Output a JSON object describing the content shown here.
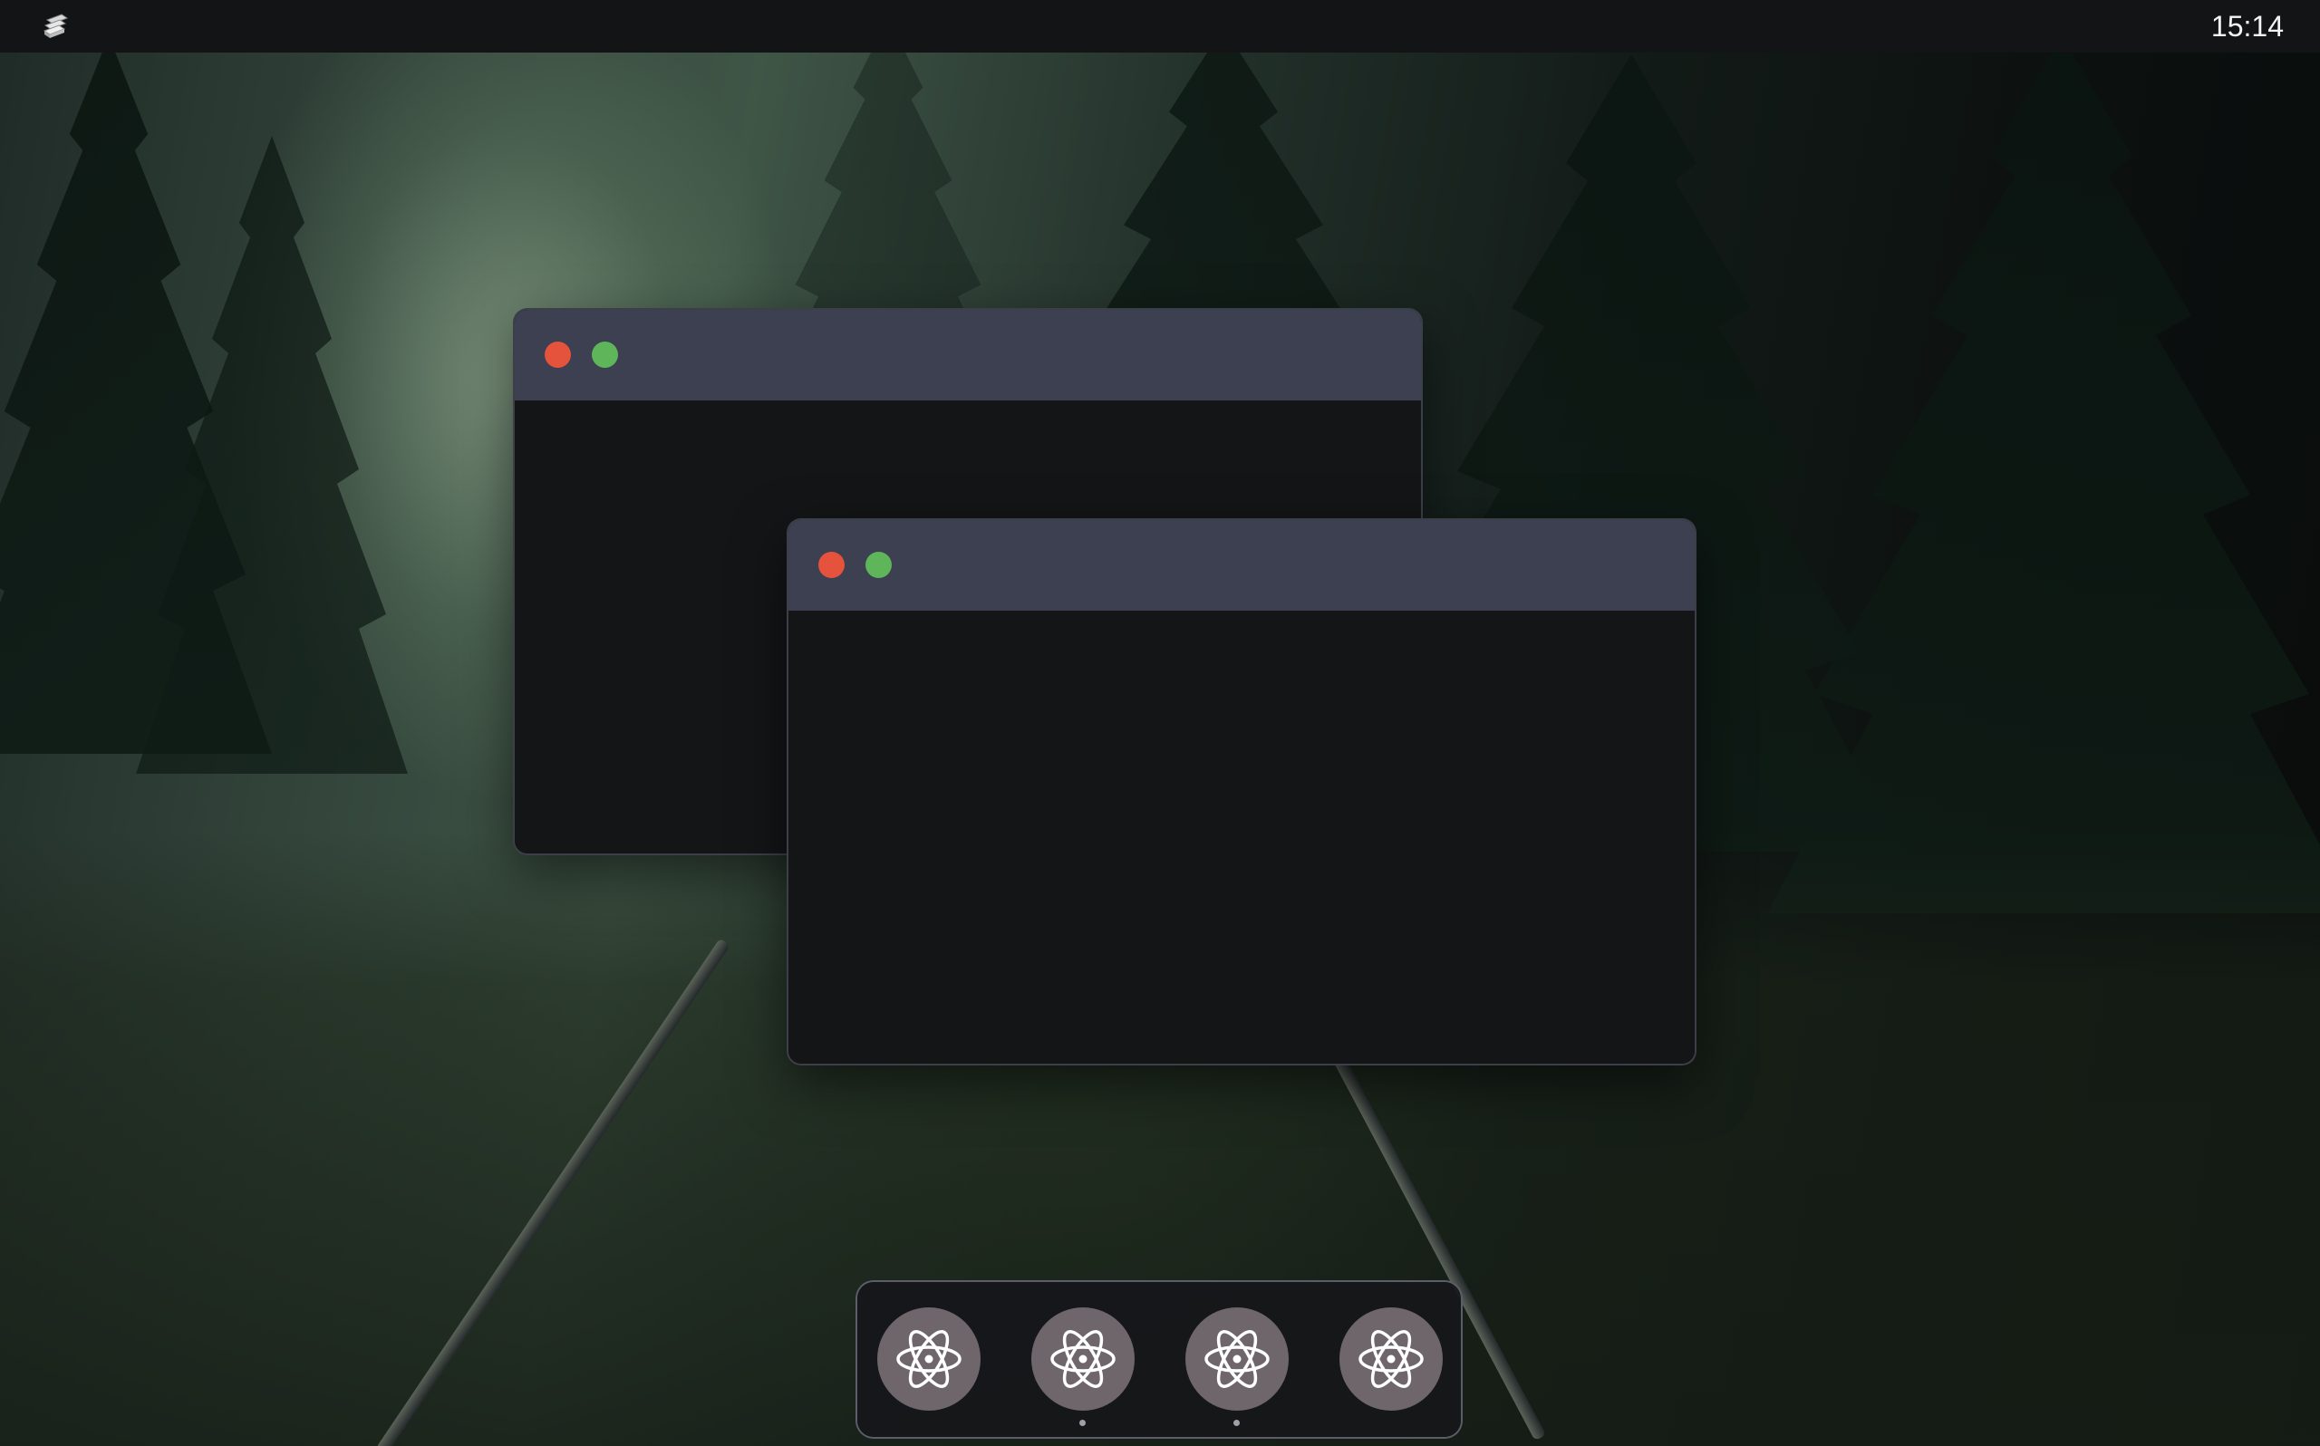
{
  "top_bar": {
    "launcher_icon": "stacked-papers-icon",
    "clock": "15:14"
  },
  "windows": [
    {
      "controls": [
        {
          "name": "close",
          "color": "#e5533d"
        },
        {
          "name": "maximize",
          "color": "#5fb65a"
        }
      ]
    },
    {
      "controls": [
        {
          "name": "close",
          "color": "#e5533d"
        },
        {
          "name": "maximize",
          "color": "#5fb65a"
        }
      ]
    }
  ],
  "dock": {
    "apps": [
      {
        "icon": "atom-icon",
        "running": false
      },
      {
        "icon": "atom-icon",
        "running": true
      },
      {
        "icon": "atom-icon",
        "running": true
      },
      {
        "icon": "atom-icon",
        "running": false
      }
    ]
  },
  "colors": {
    "topbar_bg": "#131416",
    "titlebar_bg": "#3d4050",
    "window_bg": "#141517",
    "dock_bg": "#16171a",
    "dock_icon_bg": "#6f666b"
  }
}
